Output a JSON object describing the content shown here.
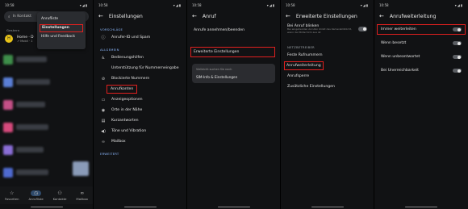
{
  "status_time": "10:58",
  "p1": {
    "search_placeholder": "In Kontakt",
    "section": "Gestern",
    "contact_name": "Home · D",
    "contact_sub": "↗ Mobil · 1",
    "menu": [
      "Anrufliste",
      "Einstellungen",
      "Hilfe und Feedback"
    ],
    "nav": [
      "Favoriten",
      "Anrufliste",
      "Kontakte",
      "Mailbox"
    ]
  },
  "p2": {
    "title": "Einstellungen",
    "sec1": "VORSCHLÄGE",
    "sug": "Anrufer-ID und Spam",
    "sec2": "ALLGEMEIN",
    "items": [
      "Bedienungshilfen",
      "Unterstützung für Nummerneingabe",
      "Blockierte Nummern",
      "Anrufkonten",
      "Anzeigeoptionen",
      "Orte in der Nähe",
      "Kurzantworten",
      "Töne und Vibration",
      "Mailbox"
    ],
    "sec3": "ERWEITERT"
  },
  "p3": {
    "title": "Anruf",
    "items": [
      "Anrufe annehmen/beenden",
      "Erweiterte Einstellungen"
    ],
    "card_title": "Vielleicht suchen Sie nach",
    "card_item": "SIM-Info & Einstellungen"
  },
  "p4": {
    "title": "Erweiterte Einstellungen",
    "bei_anruf": "Bei Anruf blinken",
    "bei_anruf_sub": "Bei eingehenden Anrufen blinkt das Kamerablitzlicht, wenn der Bildschirm aus ist",
    "sec": "NETZBETREIBER",
    "items": [
      "Feste Rufnummern",
      "Anrufweiterleitung",
      "Anrufsperre",
      "Zusätzliche Einstellungen"
    ]
  },
  "p5": {
    "title": "Anrufweiterleitung",
    "items": [
      "Immer weiterleiten",
      "Wenn besetzt",
      "Wenn unbeantwortet",
      "Bei Unerreichbarkeit"
    ]
  }
}
